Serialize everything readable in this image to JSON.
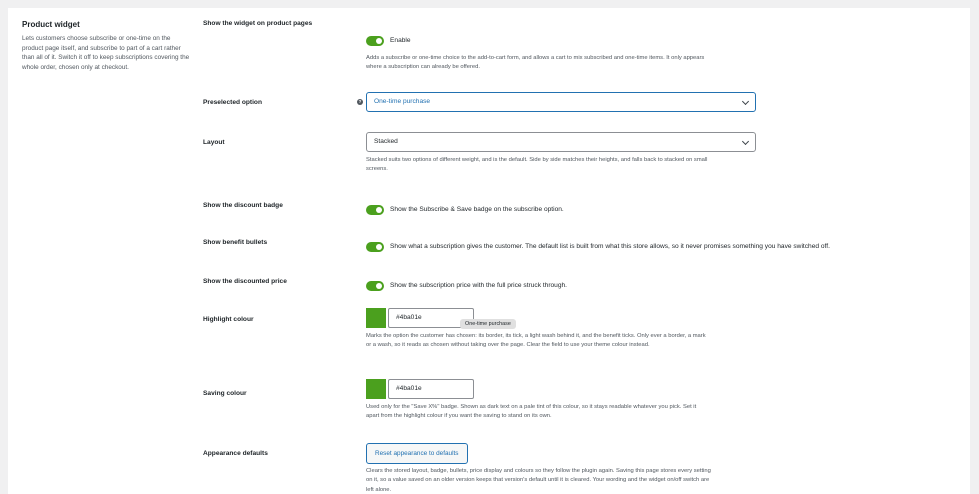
{
  "sidebar": {
    "title": "Product widget",
    "description": "Lets customers choose subscribe or one-time on the product page itself, and subscribe to part of a cart rather than all of it. Switch it off to keep subscriptions covering the whole order, chosen only at checkout."
  },
  "settings": {
    "show_widget": {
      "label": "Show the widget on product pages",
      "toggle_label": "Enable",
      "enabled": true,
      "description": "Adds a subscribe or one-time choice to the add-to-cart form, and allows a cart to mix subscribed and one-time items. It only appears where a subscription can already be offered."
    },
    "preselected": {
      "label": "Preselected option",
      "help_icon": "?",
      "value": "One-time purchase"
    },
    "layout": {
      "label": "Layout",
      "value": "Stacked",
      "description": "Stacked suits two options of different weight, and is the default. Side by side matches their heights, and falls back to stacked on small screens."
    },
    "discount_badge": {
      "label": "Show the discount badge",
      "enabled": true,
      "toggle_label": "Show the Subscribe & Save badge on the subscribe option."
    },
    "benefit_bullets": {
      "label": "Show benefit bullets",
      "enabled": true,
      "toggle_label": "Show what a subscription gives the customer. The default list is built from what this store allows, so it never promises something you have switched off."
    },
    "discounted_price": {
      "label": "Show the discounted price",
      "enabled": true,
      "toggle_label": "Show the subscription price with the full price struck through."
    },
    "highlight_colour": {
      "label": "Highlight colour",
      "value": "#4ba01e",
      "swatch_color": "#4ba01e",
      "tooltip": "One-time purchase",
      "description": "Marks the option the customer has chosen: its border, its tick, a light wash behind it, and the benefit ticks. Only ever a border, a mark or a wash, so it reads as chosen without taking over the page. Clear the field to use your theme colour instead."
    },
    "saving_colour": {
      "label": "Saving colour",
      "value": "#4ba01e",
      "swatch_color": "#4ba01e",
      "description": "Used only for the \"Save X%\" badge. Shown as dark text on a pale tint of this colour, so it stays readable whatever you pick. Set it apart from the highlight colour if you want the saving to stand on its own."
    },
    "appearance_defaults": {
      "label": "Appearance defaults",
      "button_label": "Reset appearance to defaults",
      "description": "Clears the stored layout, badge, bullets, price display and colours so they follow the plugin again. Saving this page stores every setting on it, so a value saved on an older version keeps that version's default until it is cleared. Your wording and the widget on/off switch are left alone."
    }
  },
  "colors": {
    "accent": "#4ba01e",
    "focus": "#2271b1"
  }
}
